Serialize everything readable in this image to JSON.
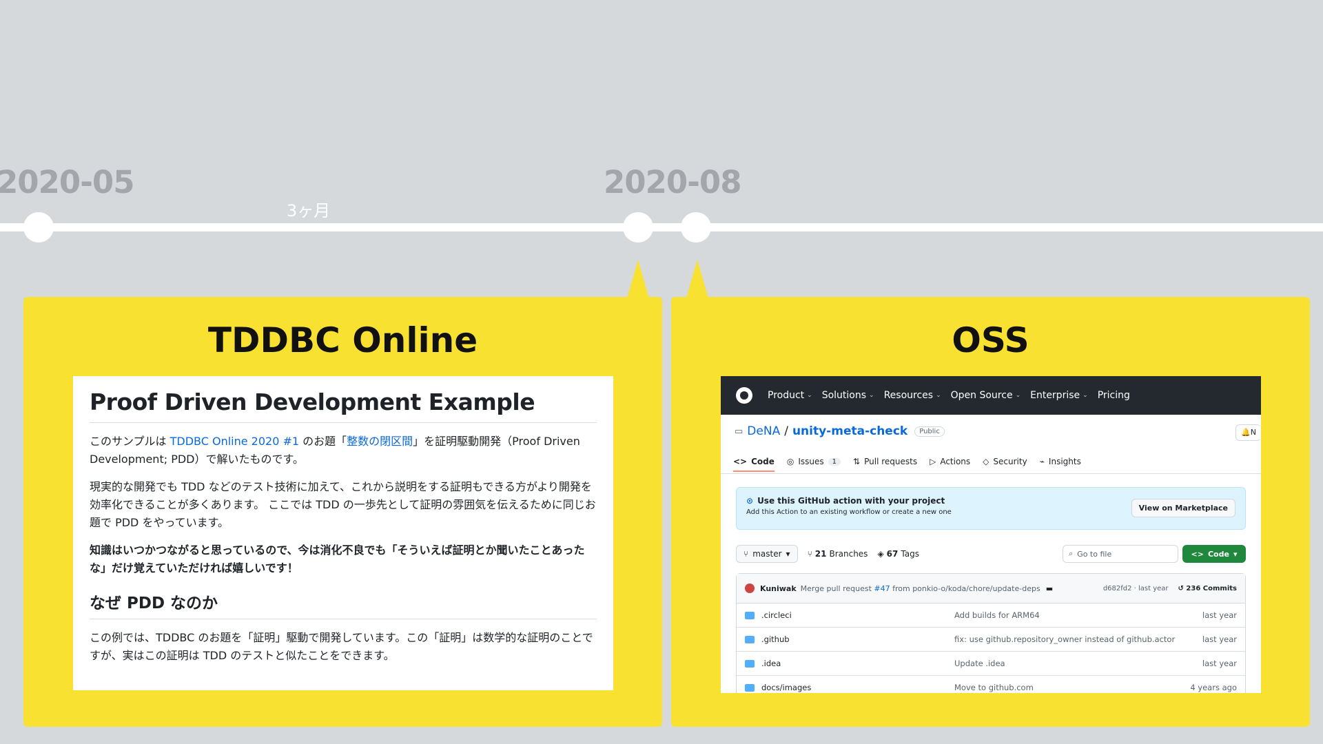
{
  "timeline": {
    "date_left": "2020-05",
    "date_right": "2020-08",
    "duration_label": "3ヶ月"
  },
  "card_left": {
    "title": "TDDBC Online",
    "doc": {
      "heading": "Proof Driven Development Example",
      "p1_before": "このサンプルは ",
      "p1_link1": "TDDBC Online 2020 #1",
      "p1_mid": " のお題「",
      "p1_link2": "整数の閉区間",
      "p1_after": "」を証明駆動開発（Proof Driven Development; PDD）で解いたものです。",
      "p2": "現実的な開発でも TDD などのテスト技術に加えて、これから説明をする証明もできる方がより開発を効率化できることが多くあります。 ここでは TDD の一歩先として証明の雰囲気を伝えるために同じお題で PDD をやっています。",
      "p3": "知識はいつかつながると思っているので、今は消化不良でも「そういえば証明とか聞いたことあったな」だけ覚えていただければ嬉しいです！",
      "subheading": "なぜ PDD なのか",
      "p4": "この例では、TDDBC のお題を「証明」駆動で開発しています。この「証明」は数学的な証明のことですが、実はこの証明は TDD のテストと似たことをできます。"
    }
  },
  "card_right": {
    "title": "OSS",
    "github": {
      "nav": [
        "Product",
        "Solutions",
        "Resources",
        "Open Source",
        "Enterprise",
        "Pricing"
      ],
      "repo_owner": "DeNA",
      "repo_sep": "/",
      "repo_name": "unity-meta-check",
      "visibility": "Public",
      "bell_label": "N",
      "tabs": [
        {
          "label": "Code",
          "icon": "code-icon"
        },
        {
          "label": "Issues",
          "icon": "issue-icon",
          "count": "1"
        },
        {
          "label": "Pull requests",
          "icon": "pull-request-icon"
        },
        {
          "label": "Actions",
          "icon": "play-icon"
        },
        {
          "label": "Security",
          "icon": "shield-icon"
        },
        {
          "label": "Insights",
          "icon": "graph-icon"
        }
      ],
      "banner_title": "Use this GitHub action with your project",
      "banner_sub": "Add this Action to an existing workflow or create a new one",
      "banner_button": "View on Marketplace",
      "branch": "master",
      "branches_count": "21",
      "branches_label": "Branches",
      "tags_count": "67",
      "tags_label": "Tags",
      "goto_placeholder": "Go to file",
      "code_button": "Code",
      "commit": {
        "author": "Kuniwak",
        "msg_before": "Merge pull request ",
        "msg_link": "#47",
        "msg_after": " from ponkio-o/koda/chore/update-deps",
        "sha_time": "d682fd2 · last year",
        "commits": "236 Commits"
      },
      "files": [
        {
          "name": ".circleci",
          "message": "Add builds for ARM64",
          "time": "last year"
        },
        {
          "name": ".github",
          "message": "fix: use github.repository_owner instead of github.actor",
          "time": "last year"
        },
        {
          "name": ".idea",
          "message": "Update .idea",
          "time": "last year"
        },
        {
          "name": "docs/images",
          "message": "Move to github.com",
          "time": "4 years ago"
        }
      ]
    }
  },
  "colors": {
    "background": "#d5d9dc",
    "card": "#f8e131",
    "timeline": "#ffffff",
    "date_text": "#a3a6aa",
    "link": "#0969da",
    "gh_header": "#24292f",
    "gh_green": "#1f883d"
  }
}
